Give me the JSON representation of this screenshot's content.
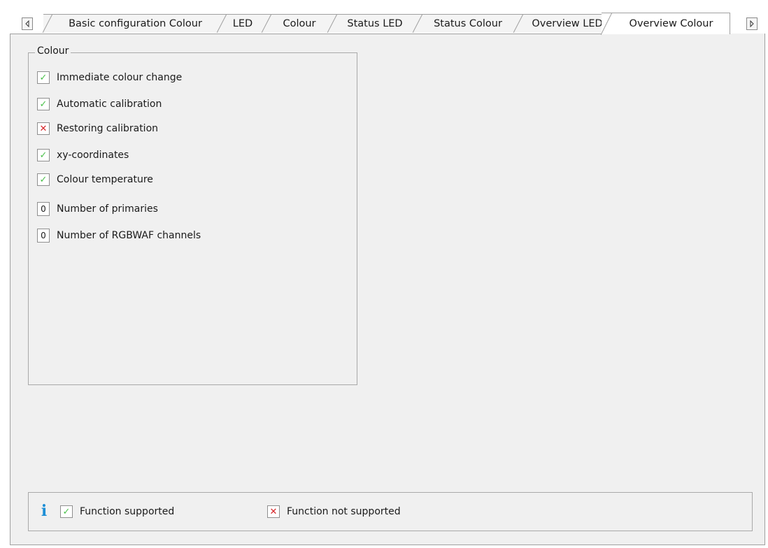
{
  "tabs": [
    {
      "label": "Basic configuration Colour",
      "active": false
    },
    {
      "label": "LED",
      "active": false
    },
    {
      "label": "Colour",
      "active": false
    },
    {
      "label": "Status LED",
      "active": false
    },
    {
      "label": "Status Colour",
      "active": false
    },
    {
      "label": "Overview LED",
      "active": false
    },
    {
      "label": "Overview Colour",
      "active": true
    }
  ],
  "scroll": {
    "left_icon": "triangle-left-icon",
    "right_icon": "triangle-right-icon"
  },
  "group": {
    "title": "Colour",
    "items": [
      {
        "label": "Immediate colour change",
        "type": "check",
        "state": "supported"
      },
      {
        "label": "Automatic calibration",
        "type": "check",
        "state": "supported"
      },
      {
        "label": "Restoring calibration",
        "type": "check",
        "state": "not-supported"
      },
      {
        "label": "xy-coordinates",
        "type": "check",
        "state": "supported"
      },
      {
        "label": "Colour temperature",
        "type": "check",
        "state": "supported"
      },
      {
        "label": "Number of primaries",
        "type": "number",
        "value": "0"
      },
      {
        "label": "Number of RGBWAF channels",
        "type": "number",
        "value": "0"
      }
    ]
  },
  "legend": {
    "info_icon": "i",
    "supported_label": "Function supported",
    "not_supported_label": "Function not supported"
  },
  "colors": {
    "check": "#4cc14c",
    "cross": "#d6262a",
    "info": "#1e8fd6"
  },
  "symbols": {
    "check": "✓",
    "cross": "✕"
  }
}
